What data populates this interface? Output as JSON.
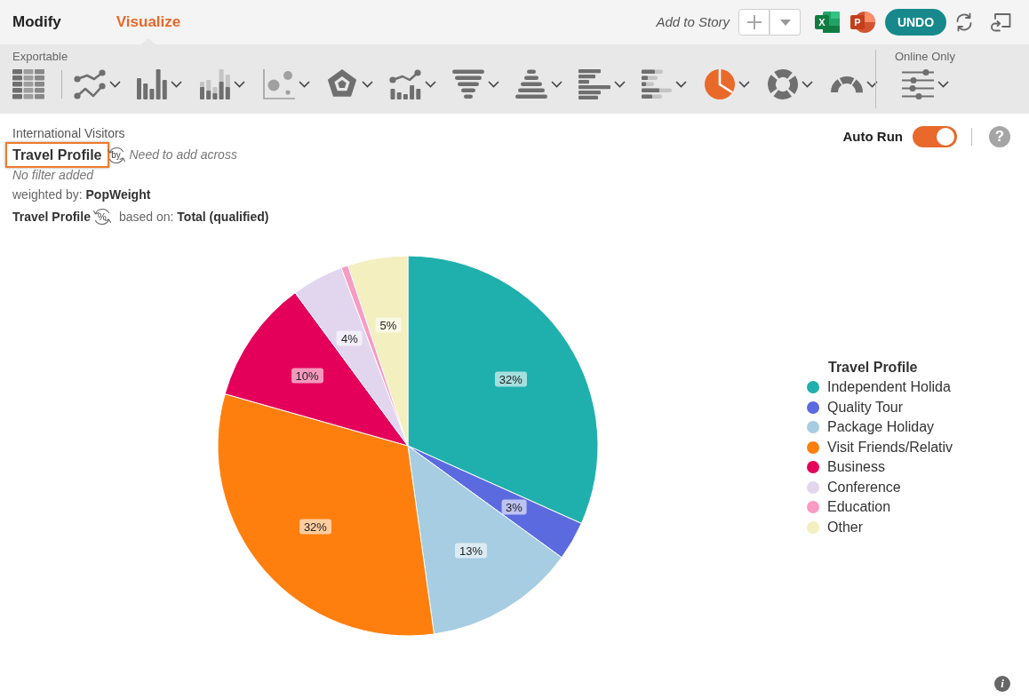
{
  "top_tabs": [
    {
      "label": "Modify",
      "selected": false
    },
    {
      "label": "Visualize",
      "selected": true
    }
  ],
  "add_to_story": {
    "label": "Add to Story"
  },
  "export_buttons": [
    {
      "kind": "spreadsheet",
      "letter": "X"
    },
    {
      "kind": "presentation",
      "letter": "P"
    }
  ],
  "undo_button": {
    "label": "UNDO"
  },
  "toolbar": {
    "exportable_label": "Exportable",
    "chart_types": [
      {
        "kind": "table",
        "selected": false
      },
      {
        "kind": "line",
        "selected": false
      },
      {
        "kind": "bar",
        "selected": false
      },
      {
        "kind": "stacked_bar",
        "selected": false
      },
      {
        "kind": "scatter",
        "selected": false
      },
      {
        "kind": "radar",
        "selected": false
      },
      {
        "kind": "combo",
        "selected": false
      },
      {
        "kind": "funnel",
        "selected": false
      },
      {
        "kind": "pyramid",
        "selected": false
      },
      {
        "kind": "hbar",
        "selected": false
      },
      {
        "kind": "stacked_hbar",
        "selected": false
      },
      {
        "kind": "pie",
        "selected": true
      },
      {
        "kind": "donut",
        "selected": false
      },
      {
        "kind": "gauge",
        "selected": false
      }
    ],
    "online_label": "Online Only",
    "online_tools": [
      {
        "kind": "sliders",
        "selected": false
      }
    ]
  },
  "header": {
    "dataset": "International Visitors",
    "row_variable": "Travel Profile",
    "row_variable_highlighted": true,
    "across_badge": "by",
    "across_placeholder": "Need to add across",
    "filter": "No filter added",
    "weighting": "weighted by: **PopWeight**",
    "percent_variable": "Travel Profile",
    "percent_badge": "%",
    "base": "based on: **Total (qualified)**"
  },
  "auto_run": {
    "label": "Auto Run",
    "on": true
  },
  "help_button": "?",
  "chart": {
    "legend_title": "Travel Profile",
    "chart_data": {
      "type": "pie",
      "categories": [
        "Independent Holida",
        "Quality Tour",
        "Package Holiday",
        "Visit Friends/Relativ",
        "Business",
        "Conference",
        "Education",
        "Other"
      ],
      "values": [
        31.7,
        3.3,
        12.8,
        31.6,
        10.5,
        4.4,
        0.6,
        5.1
      ],
      "colors": [
        "#1fb0ad",
        "#5b6bdf",
        "#a6cde2",
        "#ff7f0e",
        "#e4005a",
        "#e2d6ef",
        "#f99bc3",
        "#f3efbf"
      ],
      "value_labels": [
        "32%",
        "3%",
        "13%",
        "32%",
        "10%",
        "4%",
        null,
        "5%"
      ]
    }
  },
  "info_button": "i"
}
